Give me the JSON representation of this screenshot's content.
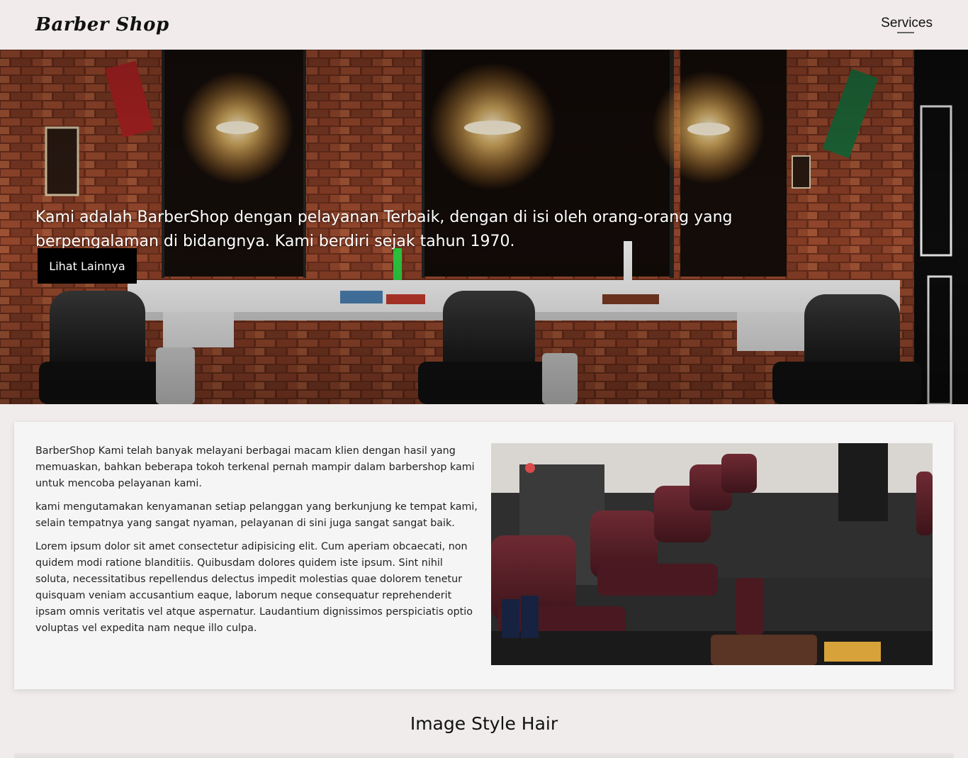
{
  "nav": {
    "brand": "Barber Shop",
    "links": [
      "Services"
    ]
  },
  "hero": {
    "text": "Kami adalah BarberShop dengan pelayanan Terbaik, dengan di isi oleh orang-orang yang berpengalaman di bidangnya. Kami berdiri sejak tahun 1970.",
    "button_label": "Lihat Lainnya"
  },
  "about": {
    "paragraphs": [
      "BarberShop Kami telah banyak melayani berbagai macam klien dengan hasil yang memuaskan, bahkan beberapa tokoh terkenal pernah mampir dalam barbershop kami untuk mencoba pelayanan kami.",
      "kami mengutamakan kenyamanan setiap pelanggan yang berkunjung ke tempat kami, selain tempatnya yang sangat nyaman, pelayanan di sini juga sangat sangat baik.",
      "Lorem ipsum dolor sit amet consectetur adipisicing elit. Cum aperiam obcaecati, non quidem modi ratione blanditiis. Quibusdam dolores quidem iste ipsum. Sint nihil soluta, necessitatibus repellendus delectus impedit molestias quae dolorem tenetur quisquam veniam accusantium eaque, laborum neque consequatur reprehenderit ipsam omnis veritatis vel atque aspernatur. Laudantium dignissimos perspiciatis optio voluptas vel expedita nam neque illo culpa."
    ]
  },
  "gallery": {
    "title": "Image Style Hair"
  },
  "colors": {
    "page_bg": "#f1ecec",
    "button_bg": "#000000",
    "card_bg": "#f5f5f5"
  }
}
